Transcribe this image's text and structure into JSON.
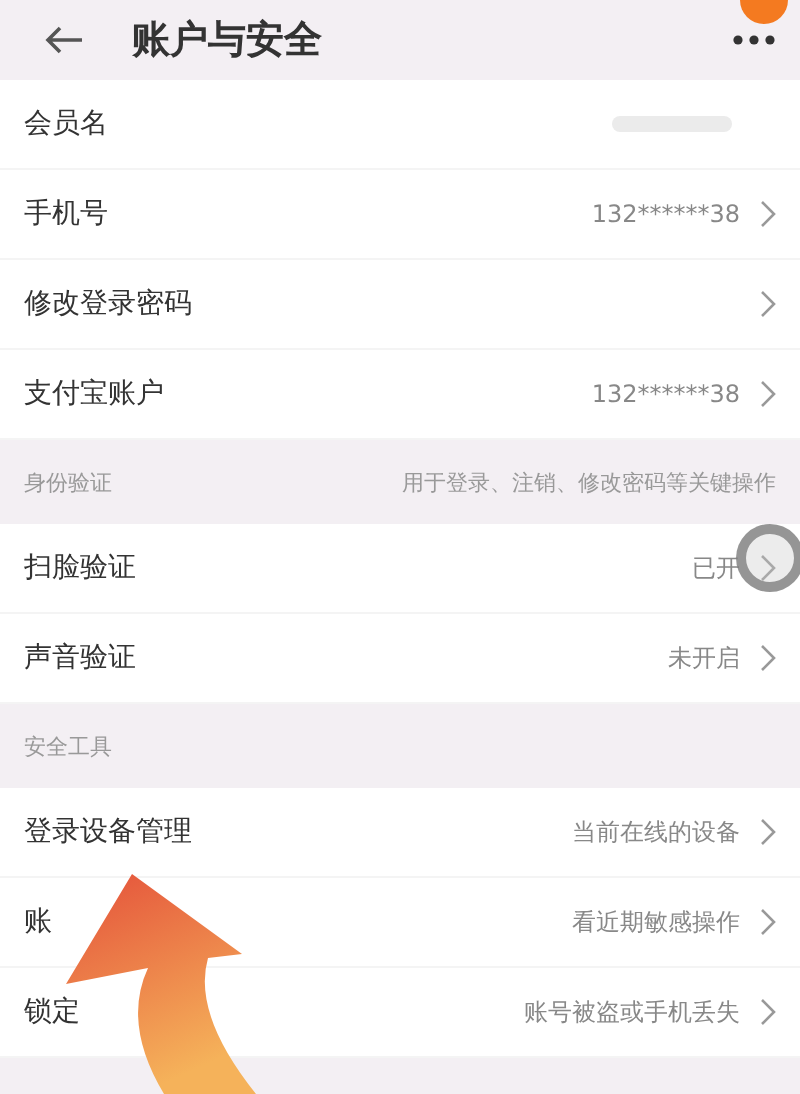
{
  "header": {
    "title": "账户与安全"
  },
  "sections": [
    {
      "rows": [
        {
          "label": "会员名"
        },
        {
          "label": "手机号",
          "value": "132******38"
        },
        {
          "label": "修改登录密码"
        },
        {
          "label": "支付宝账户",
          "value": "132******38"
        }
      ]
    },
    {
      "title": "身份验证",
      "note": "用于登录、注销、修改密码等关键操作",
      "rows": [
        {
          "label": "扫脸验证",
          "value": "已开"
        },
        {
          "label": "声音验证",
          "value": "未开启"
        }
      ]
    },
    {
      "title": "安全工具",
      "rows": [
        {
          "label": "登录设备管理",
          "value": "当前在线的设备"
        },
        {
          "label": "账",
          "value": "看近期敏感操作"
        },
        {
          "label": "锁定",
          "value": "账号被盗或手机丢失"
        }
      ]
    }
  ]
}
